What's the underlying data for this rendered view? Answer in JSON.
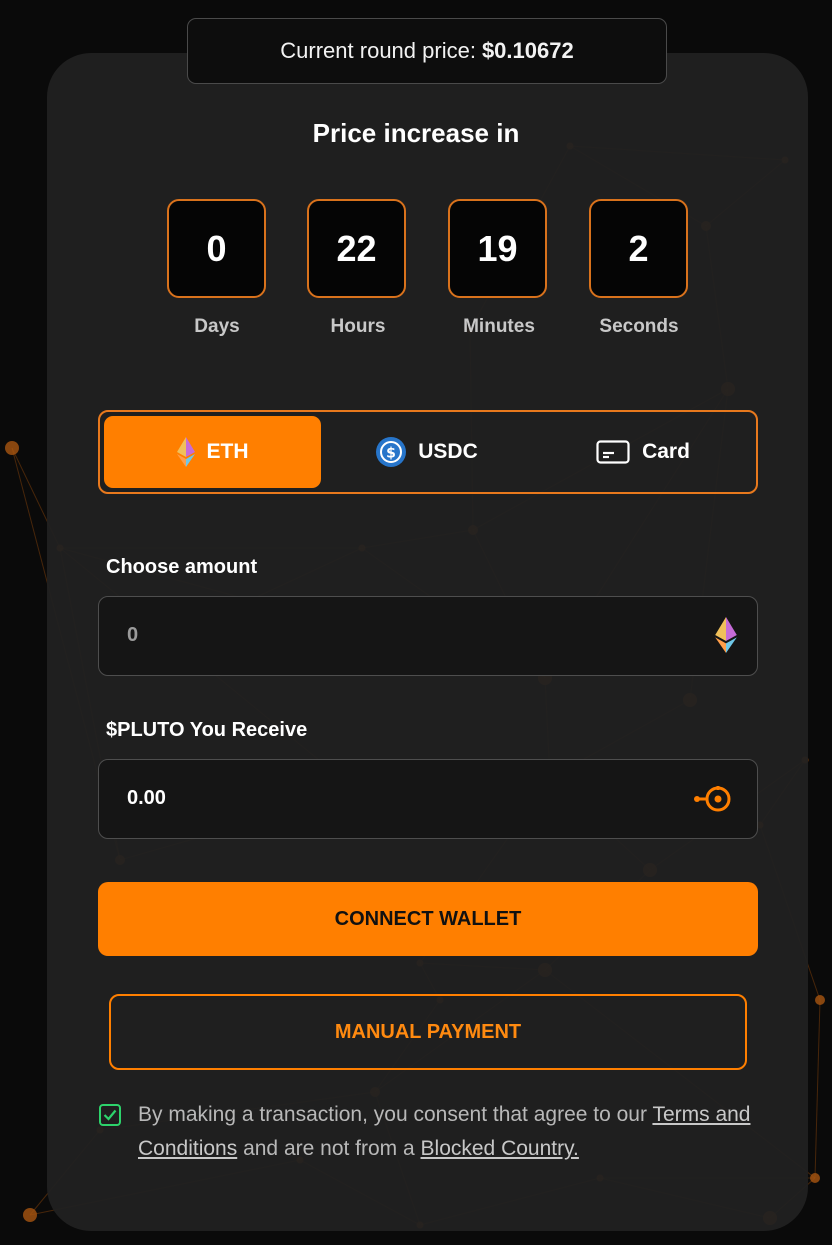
{
  "price_banner": {
    "label": "Current round price:",
    "value": "$0.10672"
  },
  "timer": {
    "title": "Price increase in",
    "units": [
      {
        "value": "0",
        "label": "Days"
      },
      {
        "value": "22",
        "label": "Hours"
      },
      {
        "value": "19",
        "label": "Minutes"
      },
      {
        "value": "2",
        "label": "Seconds"
      }
    ]
  },
  "payment_tabs": [
    {
      "label": "ETH",
      "icon": "ethereum-icon",
      "active": true
    },
    {
      "label": "USDC",
      "icon": "usdc-icon",
      "active": false
    },
    {
      "label": "Card",
      "icon": "card-icon",
      "active": false
    }
  ],
  "amount": {
    "label": "Choose amount",
    "placeholder": "0",
    "icon": "ethereum-icon"
  },
  "receive": {
    "label": "$PLUTO You Receive",
    "value": "0.00",
    "icon": "pluto-token-icon"
  },
  "buttons": {
    "connect": "CONNECT WALLET",
    "manual": "MANUAL PAYMENT"
  },
  "consent": {
    "checked": true,
    "text_before": "By making a transaction, you consent that agree to our",
    "terms_link": "Terms and Conditions",
    "text_middle": "and are not from a",
    "blocked_link": "Blocked Country."
  },
  "colors": {
    "accent": "#ff7f00",
    "card_bg": "#212121",
    "page_bg": "#0a0a0a",
    "check_green": "#2dd36b"
  }
}
